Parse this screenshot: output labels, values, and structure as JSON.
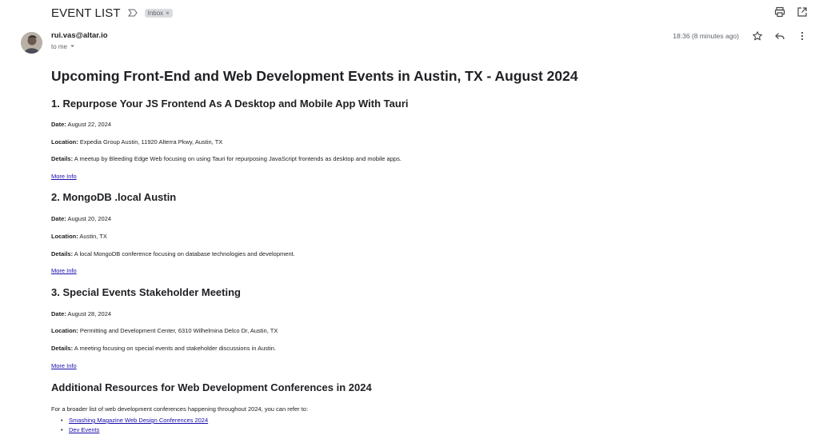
{
  "header": {
    "subject": "EVENT LIST",
    "label_chip": "Inbox",
    "label_chip_close": "×",
    "icons": [
      "print-icon",
      "open-in-new-window-icon"
    ]
  },
  "message": {
    "sender_email": "rui.vas@altar.io",
    "recipient_line": "to me",
    "time": "18:36 (8 minutes ago)",
    "icons": [
      "star-icon",
      "reply-icon",
      "more-vert-icon"
    ]
  },
  "email": {
    "title": "Upcoming Front-End and Web Development Events in Austin, TX - August 2024",
    "events": [
      {
        "heading": "1. Repurpose Your JS Frontend As A Desktop and Mobile App With Tauri",
        "date_label": "Date:",
        "date": "August 22, 2024",
        "location_label": "Location:",
        "location": "Expedia Group Austin, 11920 Alterra Pkwy, Austin, TX",
        "details_label": "Details:",
        "details": "A meetup by Bleeding Edge Web focusing on using Tauri for repurposing JavaScript frontends as desktop and mobile apps.",
        "link": "More Info"
      },
      {
        "heading": "2. MongoDB .local Austin",
        "date_label": "Date:",
        "date": "August 20, 2024",
        "location_label": "Location:",
        "location": "Austin, TX",
        "details_label": "Details:",
        "details": "A local MongoDB conference focusing on database technologies and development.",
        "link": "More Info"
      },
      {
        "heading": "3. Special Events Stakeholder Meeting",
        "date_label": "Date:",
        "date": "August 28, 2024",
        "location_label": "Location:",
        "location": "Permitting and Development Center, 6310 Wilhelmina Delco Dr, Austin, TX",
        "details_label": "Details:",
        "details": "A meeting focusing on special events and stakeholder discussions in Austin.",
        "link": "More Info"
      }
    ],
    "resources": {
      "heading": "Additional Resources for Web Development Conferences in 2024",
      "intro": "For a broader list of web development conferences happening throughout 2024, you can refer to:",
      "links": [
        "Smashing Magazine Web Design Conferences 2024",
        "Dev Events"
      ]
    }
  },
  "colors": {
    "link": "#1a0dab",
    "text": "#202124",
    "muted": "#5f6368",
    "chip": "#dadce0"
  }
}
